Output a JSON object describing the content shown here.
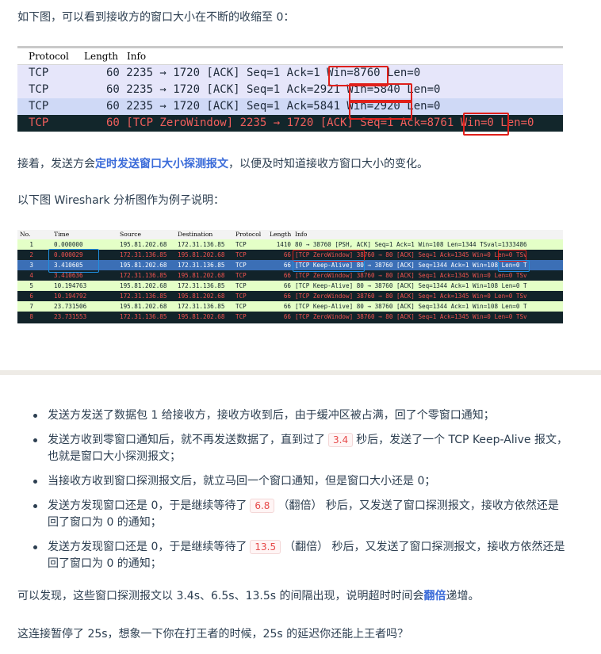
{
  "intro": "如下图，可以看到接收方的窗口大小在不断的收缩至 0：",
  "ws1": {
    "headers": [
      "Protocol",
      "Length",
      "Info"
    ],
    "rows": [
      {
        "protocol": "TCP",
        "info": "60 2235 → 1720 [ACK] Seq=1 Ack=1 Win=8760 Len=0"
      },
      {
        "protocol": "TCP",
        "info": "60 2235 → 1720 [ACK] Seq=1 Ack=2921 Win=5840 Len=0"
      },
      {
        "protocol": "TCP",
        "info": "60 2235 → 1720 [ACK] Seq=1 Ack=5841 Win=2920 Len=0"
      },
      {
        "protocol": "TCP",
        "info": "60 [TCP ZeroWindow] 2235 → 1720 [ACK] Seq=1 Ack=8761 Win=0 Len=0"
      }
    ]
  },
  "p2": {
    "before": "接着，发送方会",
    "highlight": "定时发送窗口大小探测报文",
    "after": "，以便及时知道接收方窗口大小的变化。"
  },
  "p3": "以下图 Wireshark 分析图作为例子说明：",
  "ws2": {
    "headers": [
      "No.",
      "Time",
      "Source",
      "Destination",
      "Protocol",
      "Length",
      "Info"
    ],
    "rows": [
      {
        "no": "1",
        "time": "0.000000",
        "src": "195.81.202.68",
        "dst": "172.31.136.85",
        "proto": "TCP",
        "len": "1410",
        "info": "80 → 38760 [PSH, ACK] Seq=1 Ack=1 Win=108 Len=1344 TSval=1333486"
      },
      {
        "no": "2",
        "time": "0.000029",
        "src": "172.31.136.85",
        "dst": "195.81.202.68",
        "proto": "TCP",
        "len": "66",
        "info": "[TCP ZeroWindow] 38760 → 80 [ACK] Seq=1 Ack=1345 Win=0 Len=0 TSv"
      },
      {
        "no": "3",
        "time": "3.410605",
        "src": "195.81.202.68",
        "dst": "172.31.136.85",
        "proto": "TCP",
        "len": "66",
        "info": "[TCP Keep-Alive] 80 → 38760 [ACK] Seq=1344 Ack=1 Win=108 Len=0 T"
      },
      {
        "no": "4",
        "time": "3.410636",
        "src": "172.31.136.85",
        "dst": "195.81.202.68",
        "proto": "TCP",
        "len": "66",
        "info": "[TCP ZeroWindow] 38760 → 80 [ACK] Seq=1 Ack=1345 Win=0 Len=0 TSv"
      },
      {
        "no": "5",
        "time": "10.194763",
        "src": "195.81.202.68",
        "dst": "172.31.136.85",
        "proto": "TCP",
        "len": "66",
        "info": "[TCP Keep-Alive] 80 → 38760 [ACK] Seq=1344 Ack=1 Win=108 Len=0 T"
      },
      {
        "no": "6",
        "time": "10.194792",
        "src": "172.31.136.85",
        "dst": "195.81.202.68",
        "proto": "TCP",
        "len": "66",
        "info": "[TCP ZeroWindow] 38760 → 80 [ACK] Seq=1 Ack=1345 Win=0 Len=0 TSv"
      },
      {
        "no": "7",
        "time": "23.731506",
        "src": "195.81.202.68",
        "dst": "172.31.136.85",
        "proto": "TCP",
        "len": "66",
        "info": "[TCP Keep-Alive] 80 → 38760 [ACK] Seq=1344 Ack=1 Win=108 Len=0 T"
      },
      {
        "no": "8",
        "time": "23.731553",
        "src": "172.31.136.85",
        "dst": "195.81.202.68",
        "proto": "TCP",
        "len": "66",
        "info": "[TCP ZeroWindow] 38760 → 80 [ACK] Seq=1 Ack=1345 Win=0 Len=0 TSv"
      }
    ]
  },
  "bullets": [
    {
      "pre": "发送方发送了数据包 1 给接收方，接收方收到后，由于缓冲区被占满，回了个零窗口通知；",
      "code": "",
      "post": ""
    },
    {
      "pre": "发送方收到零窗口通知后，就不再发送数据了，直到过了",
      "code": "3.4",
      "post": "秒后，发送了一个 TCP Keep-Alive 报文，也就是窗口大小探测报文；"
    },
    {
      "pre": "当接收方收到窗口探测报文后，就立马回一个窗口通知，但是窗口大小还是 0；",
      "code": "",
      "post": ""
    },
    {
      "pre": "发送方发现窗口还是 0，于是继续等待了",
      "code": "6.8",
      "post": "（翻倍） 秒后，又发送了窗口探测报文，接收方依然还是回了窗口为 0 的通知；"
    },
    {
      "pre": "发送方发现窗口还是 0，于是继续等待了",
      "code": "13.5",
      "post": "（翻倍） 秒后，又发送了窗口探测报文，接收方依然还是回了窗口为 0 的通知；"
    }
  ],
  "p4": {
    "before": "可以发现，这些窗口探测报文以 3.4s、6.5s、13.5s 的间隔出现，说明超时时间会",
    "highlight": "翻倍",
    "after": "递增。"
  },
  "p5": "这连接暂停了 25s，想象一下你在打王者的时候，25s 的延迟你还能上王者吗？"
}
